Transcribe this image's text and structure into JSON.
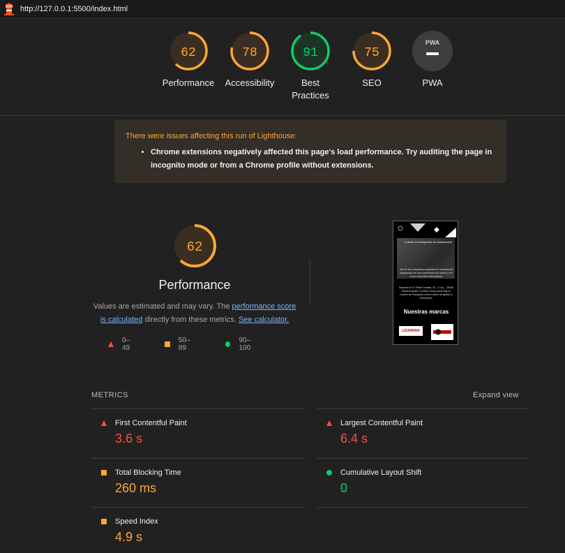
{
  "browser": {
    "url": "http://127.0.0.1:5500/index.html",
    "favicon": "lighthouse-icon"
  },
  "categories": [
    {
      "label": "Performance",
      "score": "62",
      "fraction": 0.62,
      "color": "#ffa733",
      "bg": "#3a2e22"
    },
    {
      "label": "Accessibility",
      "score": "78",
      "fraction": 0.78,
      "color": "#ffa733",
      "bg": "#3a2e22"
    },
    {
      "label": "Best Practices",
      "score": "91",
      "fraction": 0.91,
      "color": "#0cce6b",
      "bg": "#1d3326"
    },
    {
      "label": "SEO",
      "score": "75",
      "fraction": 0.75,
      "color": "#ffa733",
      "bg": "#3a2e22"
    },
    {
      "label": "PWA",
      "badge": "PWA"
    }
  ],
  "warning": {
    "title": "There were issues affecting this run of Lighthouse:",
    "item": "Chrome extensions negatively affected this page's load performance. Try auditing the page in incognito mode or from a Chrome profile without extensions."
  },
  "performance": {
    "score": "62",
    "fraction": 0.62,
    "title": "Performance",
    "desc_prefix": "Values are estimated and may vary. The ",
    "desc_link1": "performance score is calculated",
    "desc_middle": " directly from these metrics. ",
    "desc_link2": "See calculator."
  },
  "legend": [
    {
      "range": "0–49",
      "icon": "red-triangle-icon"
    },
    {
      "range": "50–89",
      "icon": "orange-square-icon"
    },
    {
      "range": "90–100",
      "icon": "green-circle-icon"
    }
  ],
  "screenshot": {
    "hero_text": "Líderes en franquicias de restauración",
    "para1": "Una de las compañías españolas de restauración organizada con más experiencia del sector y con mayor presencia internacional.",
    "para2": "Situados en C/ Padre Damián, 42 - 1º Izq. - 28036 Madrid España, Comess Group opera bajo el modelo de Franquicia como modelo de gestión y crecimiento.",
    "brands": "Nuestras marcas",
    "logo1": "LIZARRAN"
  },
  "metrics": {
    "heading": "METRICS",
    "expand": "Expand view",
    "items": [
      {
        "name": "First Contentful Paint",
        "value": "3.6 s",
        "status": "red"
      },
      {
        "name": "Largest Contentful Paint",
        "value": "6.4 s",
        "status": "red"
      },
      {
        "name": "Total Blocking Time",
        "value": "260 ms",
        "status": "orange"
      },
      {
        "name": "Cumulative Layout Shift",
        "value": "0",
        "status": "green"
      },
      {
        "name": "Speed Index",
        "value": "4.9 s",
        "status": "orange"
      }
    ]
  }
}
